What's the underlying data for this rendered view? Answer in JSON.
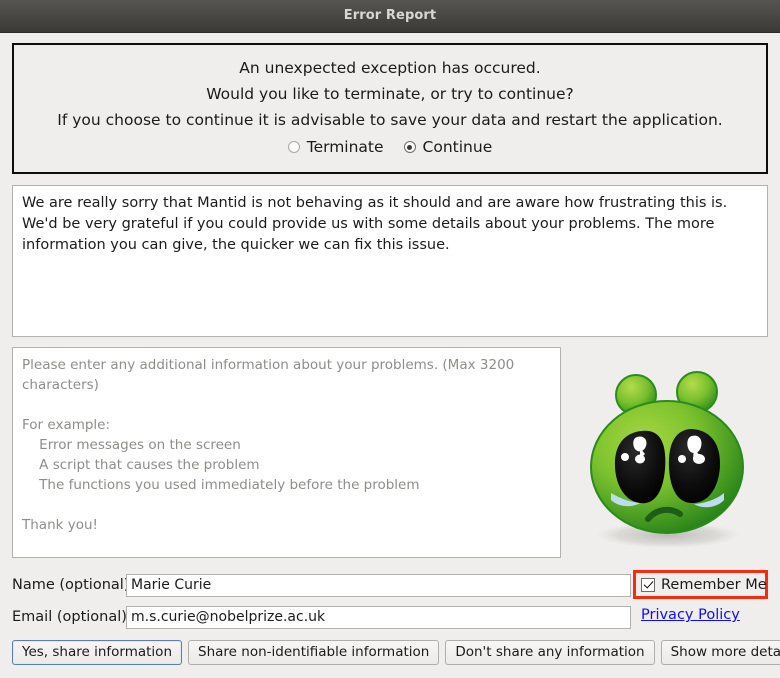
{
  "window": {
    "title": "Error Report"
  },
  "message_panel": {
    "lines": [
      "An unexpected exception has occured.",
      "Would you like to terminate, or try to continue?",
      "If you choose to continue it is advisable to save your data and restart the application."
    ],
    "options": [
      {
        "label": "Terminate",
        "selected": false
      },
      {
        "label": "Continue",
        "selected": true
      }
    ]
  },
  "apology": {
    "text": "We are really sorry that Mantid is not behaving as it should and are aware how frustrating this is. We'd be very grateful if you could provide us with some details about your problems. The more information you can give, the quicker we can fix this issue."
  },
  "details": {
    "placeholder": "Please enter any additional information about your problems. (Max 3200 characters)\n\nFor example:\n    Error messages on the screen\n    A script that causes the problem\n    The functions you used immediately before the problem\n\nThank you!",
    "value": ""
  },
  "mascot": {
    "icon": "sad-alien-icon",
    "colors": {
      "body_light": "#8ec63f",
      "body_dark": "#2e8b1f",
      "eye": "#0d0d0d",
      "tear": "#bcdcf0"
    }
  },
  "fields": {
    "name": {
      "label": "Name (optional)",
      "value": "Marie Curie",
      "placeholder": ""
    },
    "email": {
      "label": "Email (optional)",
      "value": "m.s.curie@nobelprize.ac.uk",
      "placeholder": ""
    }
  },
  "remember": {
    "label": "Remember Me",
    "checked": true,
    "highlight_color": "#f52b12"
  },
  "privacy": {
    "label": "Privacy Policy",
    "color": "#1010ef"
  },
  "buttons": [
    {
      "label": "Yes, share information",
      "focused": true
    },
    {
      "label": "Share non-identifiable information",
      "focused": false
    },
    {
      "label": "Don't share any information",
      "focused": false
    },
    {
      "label": "Show more details",
      "focused": false
    }
  ]
}
